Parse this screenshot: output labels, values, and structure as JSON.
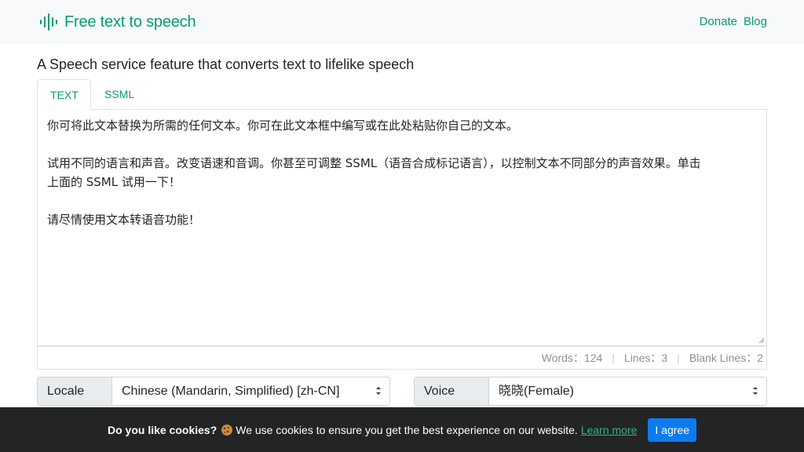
{
  "navbar": {
    "brand_icon": "waveform-icon",
    "brand": "Free text to speech",
    "links": [
      "Donate",
      "Blog"
    ],
    "accent_color": "#079c6f"
  },
  "heading": "A Speech service feature that converts text to lifelike speech",
  "tabs": [
    {
      "label": "TEXT",
      "active": true
    },
    {
      "label": "SSML",
      "active": false
    }
  ],
  "editor": {
    "lines": [
      "你可将此文本替换为所需的任何文本。你可在此文本框中编写或在此处粘贴你自己的文本。",
      "",
      "试用不同的语言和声音。改变语速和音调。你甚至可调整 SSML（语音合成标记语言），以控制文本不同部分的声音效果。单击",
      "上面的 SSML 试用一下！",
      "",
      "请尽情使用文本转语音功能！"
    ]
  },
  "stats": {
    "words_label": "Words：",
    "words": "124",
    "lines_label": "Lines：",
    "lines": "3",
    "blank_label": "Blank Lines：",
    "blank": "2"
  },
  "locale": {
    "label": "Locale",
    "value": "Chinese (Mandarin, Simplified) [zh-CN]"
  },
  "voice": {
    "label": "Voice",
    "value": "晓晓(Female)"
  },
  "cookie": {
    "bold": "Do you like cookies?",
    "emoji_icon": "cookie-icon",
    "text": "We use cookies to ensure you get the best experience on our website.",
    "link": "Learn more",
    "button": "I agree",
    "button_color": "#0d7bf0"
  }
}
